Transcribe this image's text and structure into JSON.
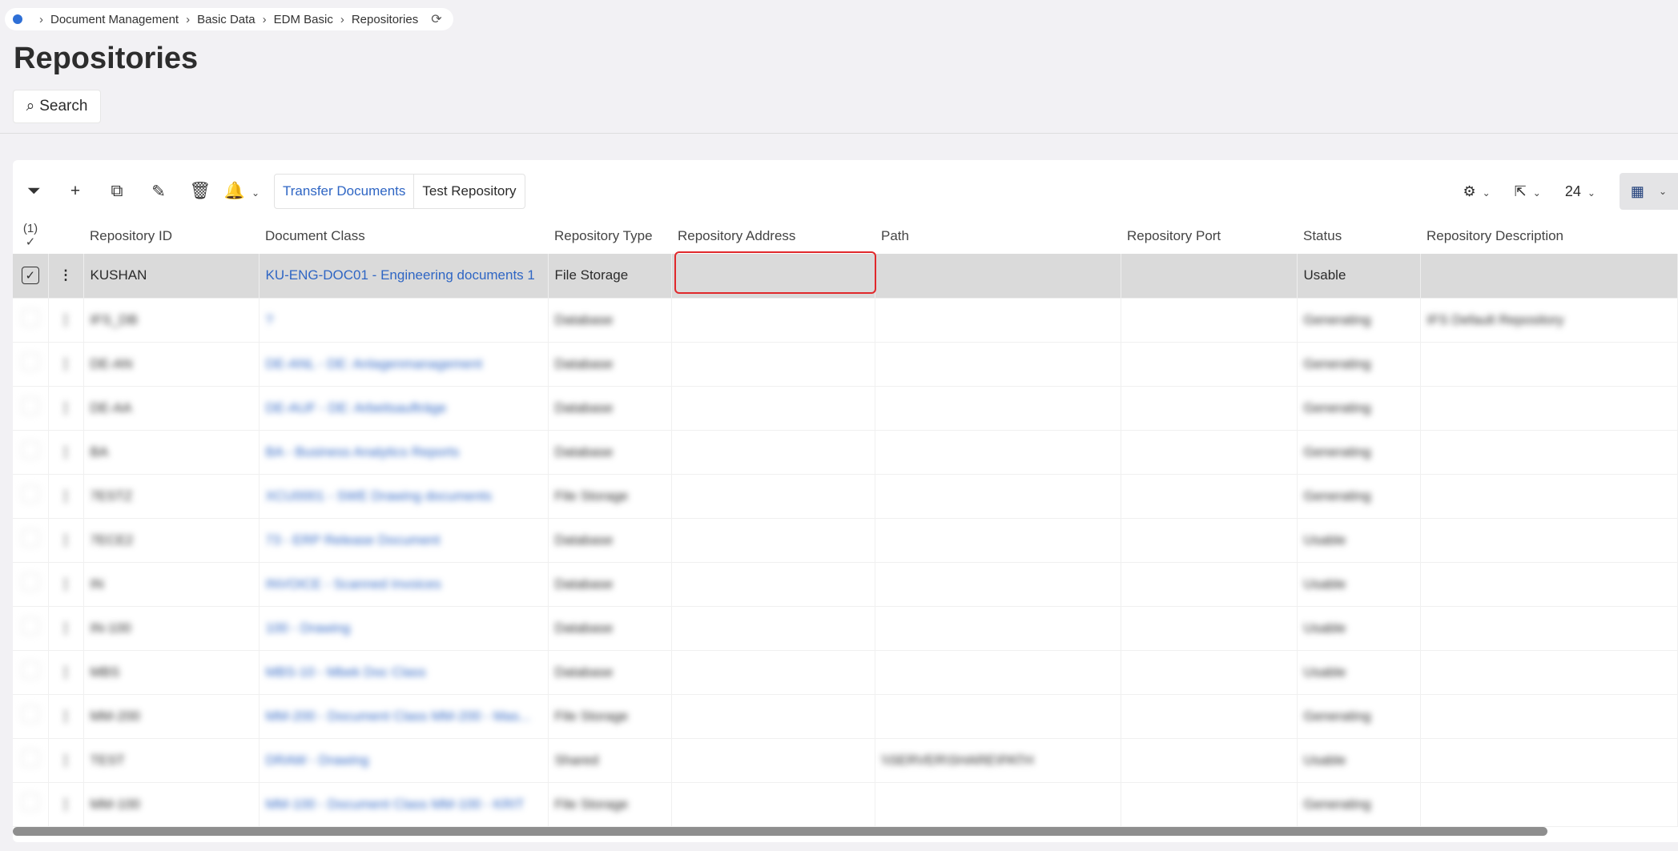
{
  "breadcrumb": [
    "Document Management",
    "Basic Data",
    "EDM Basic",
    "Repositories"
  ],
  "page_title": "Repositories",
  "search_label": "Search",
  "toolbar": {
    "transfer": "Transfer Documents",
    "test": "Test Repository",
    "page_size": "24"
  },
  "selection_count": "(1)",
  "columns": [
    "Repository ID",
    "Document Class",
    "Repository Type",
    "Repository Address",
    "Path",
    "Repository Port",
    "Status",
    "Repository Description"
  ],
  "rows": [
    {
      "id": "KUSHAN",
      "doc_class": "KU-ENG-DOC01 - Engineering documents 1",
      "type": "File Storage",
      "address": "",
      "path": "",
      "port": "",
      "status": "Usable",
      "desc": ""
    },
    {
      "id": "IFS_DB",
      "doc_class": "?",
      "type": "Database",
      "address": "",
      "path": "",
      "port": "",
      "status": "Generating",
      "desc": "IFS Default Repository"
    },
    {
      "id": "DE-AN",
      "doc_class": "DE-ANL - DE: Anlagenmanagement",
      "type": "Database",
      "address": "",
      "path": "",
      "port": "",
      "status": "Generating",
      "desc": ""
    },
    {
      "id": "DE-AA",
      "doc_class": "DE-AUF - DE: Arbeitsaufträge",
      "type": "Database",
      "address": "",
      "path": "",
      "port": "",
      "status": "Generating",
      "desc": ""
    },
    {
      "id": "BA",
      "doc_class": "BA - Business Analytics Reports",
      "type": "Database",
      "address": "",
      "path": "",
      "port": "",
      "status": "Generating",
      "desc": ""
    },
    {
      "id": "7ESTZ",
      "doc_class": "XCU0001 - SWE Drawing documents",
      "type": "File Storage",
      "address": "",
      "path": "",
      "port": "",
      "status": "Generating",
      "desc": ""
    },
    {
      "id": "7ECE2",
      "doc_class": "73 - ERP Release Document",
      "type": "Database",
      "address": "",
      "path": "",
      "port": "",
      "status": "Usable",
      "desc": ""
    },
    {
      "id": "IN",
      "doc_class": "INVOICE - Scanned Invoices",
      "type": "Database",
      "address": "",
      "path": "",
      "port": "",
      "status": "Usable",
      "desc": ""
    },
    {
      "id": "IN-100",
      "doc_class": "100 - Drawing",
      "type": "Database",
      "address": "",
      "path": "",
      "port": "",
      "status": "Usable",
      "desc": ""
    },
    {
      "id": "MBS",
      "doc_class": "MBS-10 - Mbek Doc Class",
      "type": "Database",
      "address": "",
      "path": "",
      "port": "",
      "status": "Usable",
      "desc": ""
    },
    {
      "id": "MM-200",
      "doc_class": "MM-200 - Document Class MM-200 - Mas...",
      "type": "File Storage",
      "address": "",
      "path": "",
      "port": "",
      "status": "Generating",
      "desc": ""
    },
    {
      "id": "TEST",
      "doc_class": "DRAW - Drawing",
      "type": "Shared",
      "address": "",
      "path": "\\\\SERVER\\SHARE\\PATH",
      "port": "",
      "status": "Usable",
      "desc": ""
    },
    {
      "id": "MM-100",
      "doc_class": "MM-100 - Document Class MM-100 - KRIT",
      "type": "File Storage",
      "address": "",
      "path": "",
      "port": "",
      "status": "Generating",
      "desc": ""
    }
  ]
}
